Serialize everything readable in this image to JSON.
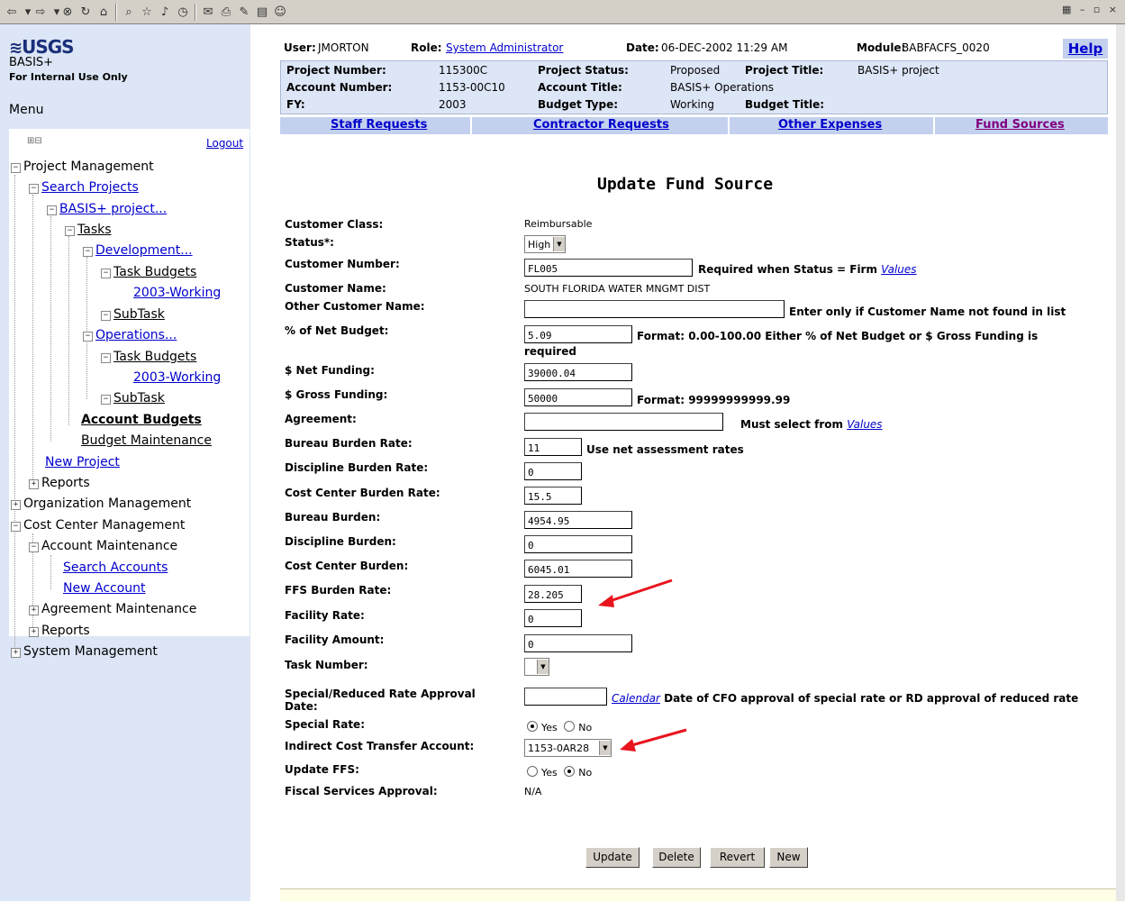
{
  "header": {
    "user_label": "User:",
    "user": "JMORTON",
    "role_label": "Role:",
    "role": "System Administrator",
    "date_label": "Date:",
    "date": "06-DEC-2002 11:29 AM",
    "module_label": "Module:",
    "module": "BABFACFS_0020",
    "help": "Help",
    "project_number_label": "Project Number:",
    "project_number": "115300C",
    "project_status_label": "Project Status:",
    "project_status": "Proposed",
    "project_title_label": "Project Title:",
    "project_title": "BASIS+ project",
    "account_number_label": "Account Number:",
    "account_number": "1153-00C10",
    "account_title_label": "Account Title:",
    "account_title": "BASIS+ Operations",
    "fy_label": "FY:",
    "fy": "2003",
    "budget_type_label": "Budget Type:",
    "budget_type": "Working",
    "budget_title_label": "Budget Title:",
    "budget_title": ""
  },
  "tabs": [
    "Staff Requests",
    "Contractor Requests",
    "Other Expenses",
    "Fund Sources"
  ],
  "sidebar": {
    "logo": "USGS",
    "app_name": "BASIS+",
    "internal": "For Internal Use Only",
    "menu": "Menu",
    "logout": "Logout",
    "tree": [
      "Project Management",
      "Search Projects",
      "BASIS+ project...",
      "Tasks",
      "Development...",
      "Task Budgets",
      "2003-Working",
      "SubTask",
      "Operations...",
      "Task Budgets",
      "2003-Working",
      "SubTask",
      "Account Budgets",
      "Budget Maintenance",
      "New Project",
      "Reports",
      "Organization Management",
      "Cost Center Management",
      "Account Maintenance",
      "Search Accounts",
      "New Account",
      "Agreement Maintenance",
      "Reports",
      "System Management"
    ]
  },
  "form": {
    "title": "Update Fund Source",
    "customer_class_label": "Customer Class:",
    "customer_class": "Reimbursable",
    "status_label": "Status*:",
    "status": "High",
    "customer_number_label": "Customer Number:",
    "customer_number": "FL005",
    "customer_number_note": "Required when Status = Firm",
    "values_link": "Values",
    "customer_name_label": "Customer Name:",
    "customer_name": "SOUTH FLORIDA WATER MNGMT DIST",
    "other_customer_label": "Other Customer Name:",
    "other_customer": "",
    "other_customer_note": "Enter only if Customer Name not found in list",
    "pct_net_label": "% of Net Budget:",
    "pct_net": "5.09",
    "pct_net_note": "Format: 0.00-100.00 Either % of Net Budget or $ Gross Funding is",
    "pct_net_note2": "required",
    "net_funding_label": "$ Net Funding:",
    "net_funding": "39000.04",
    "gross_funding_label": "$ Gross Funding:",
    "gross_funding": "50000",
    "gross_funding_note": "Format: 99999999999.99",
    "agreement_label": "Agreement:",
    "agreement": "",
    "agreement_note": "Must select from",
    "bureau_rate_label": "Bureau Burden Rate:",
    "bureau_rate": "11",
    "bureau_rate_note": "Use net assessment rates",
    "discipline_rate_label": "Discipline Burden Rate:",
    "discipline_rate": "0",
    "cc_rate_label": "Cost Center Burden Rate:",
    "cc_rate": "15.5",
    "bureau_burden_label": "Bureau Burden:",
    "bureau_burden": "4954.95",
    "discipline_burden_label": "Discipline Burden:",
    "discipline_burden": "0",
    "cc_burden_label": "Cost Center Burden:",
    "cc_burden": "6045.01",
    "ffs_rate_label": "FFS Burden Rate:",
    "ffs_rate": "28.205",
    "facility_rate_label": "Facility Rate:",
    "facility_rate": "0",
    "facility_amount_label": "Facility Amount:",
    "facility_amount": "0",
    "task_number_label": "Task Number:",
    "task_number": "",
    "special_date_label": "Special/Reduced Rate Approval",
    "special_date_label2": "Date:",
    "special_date": "",
    "calendar_link": "Calendar",
    "special_date_note": "Date of CFO approval of special rate or RD approval of reduced rate",
    "special_rate_label": "Special Rate:",
    "yes": "Yes",
    "no": "No",
    "ict_label": "Indirect Cost Transfer Account:",
    "ict": "1153-0AR28",
    "update_ffs_label": "Update FFS:",
    "fiscal_label": "Fiscal Services Approval:",
    "fiscal": "N/A"
  },
  "buttons": {
    "update": "Update",
    "delete": "Delete",
    "revert": "Revert",
    "new": "New"
  },
  "colors": {
    "link": "#0000cc",
    "sidebar_bg": "#dde6f6",
    "tab_bg": "#c3d1ee",
    "annotation_arrow": "#e8141e"
  }
}
